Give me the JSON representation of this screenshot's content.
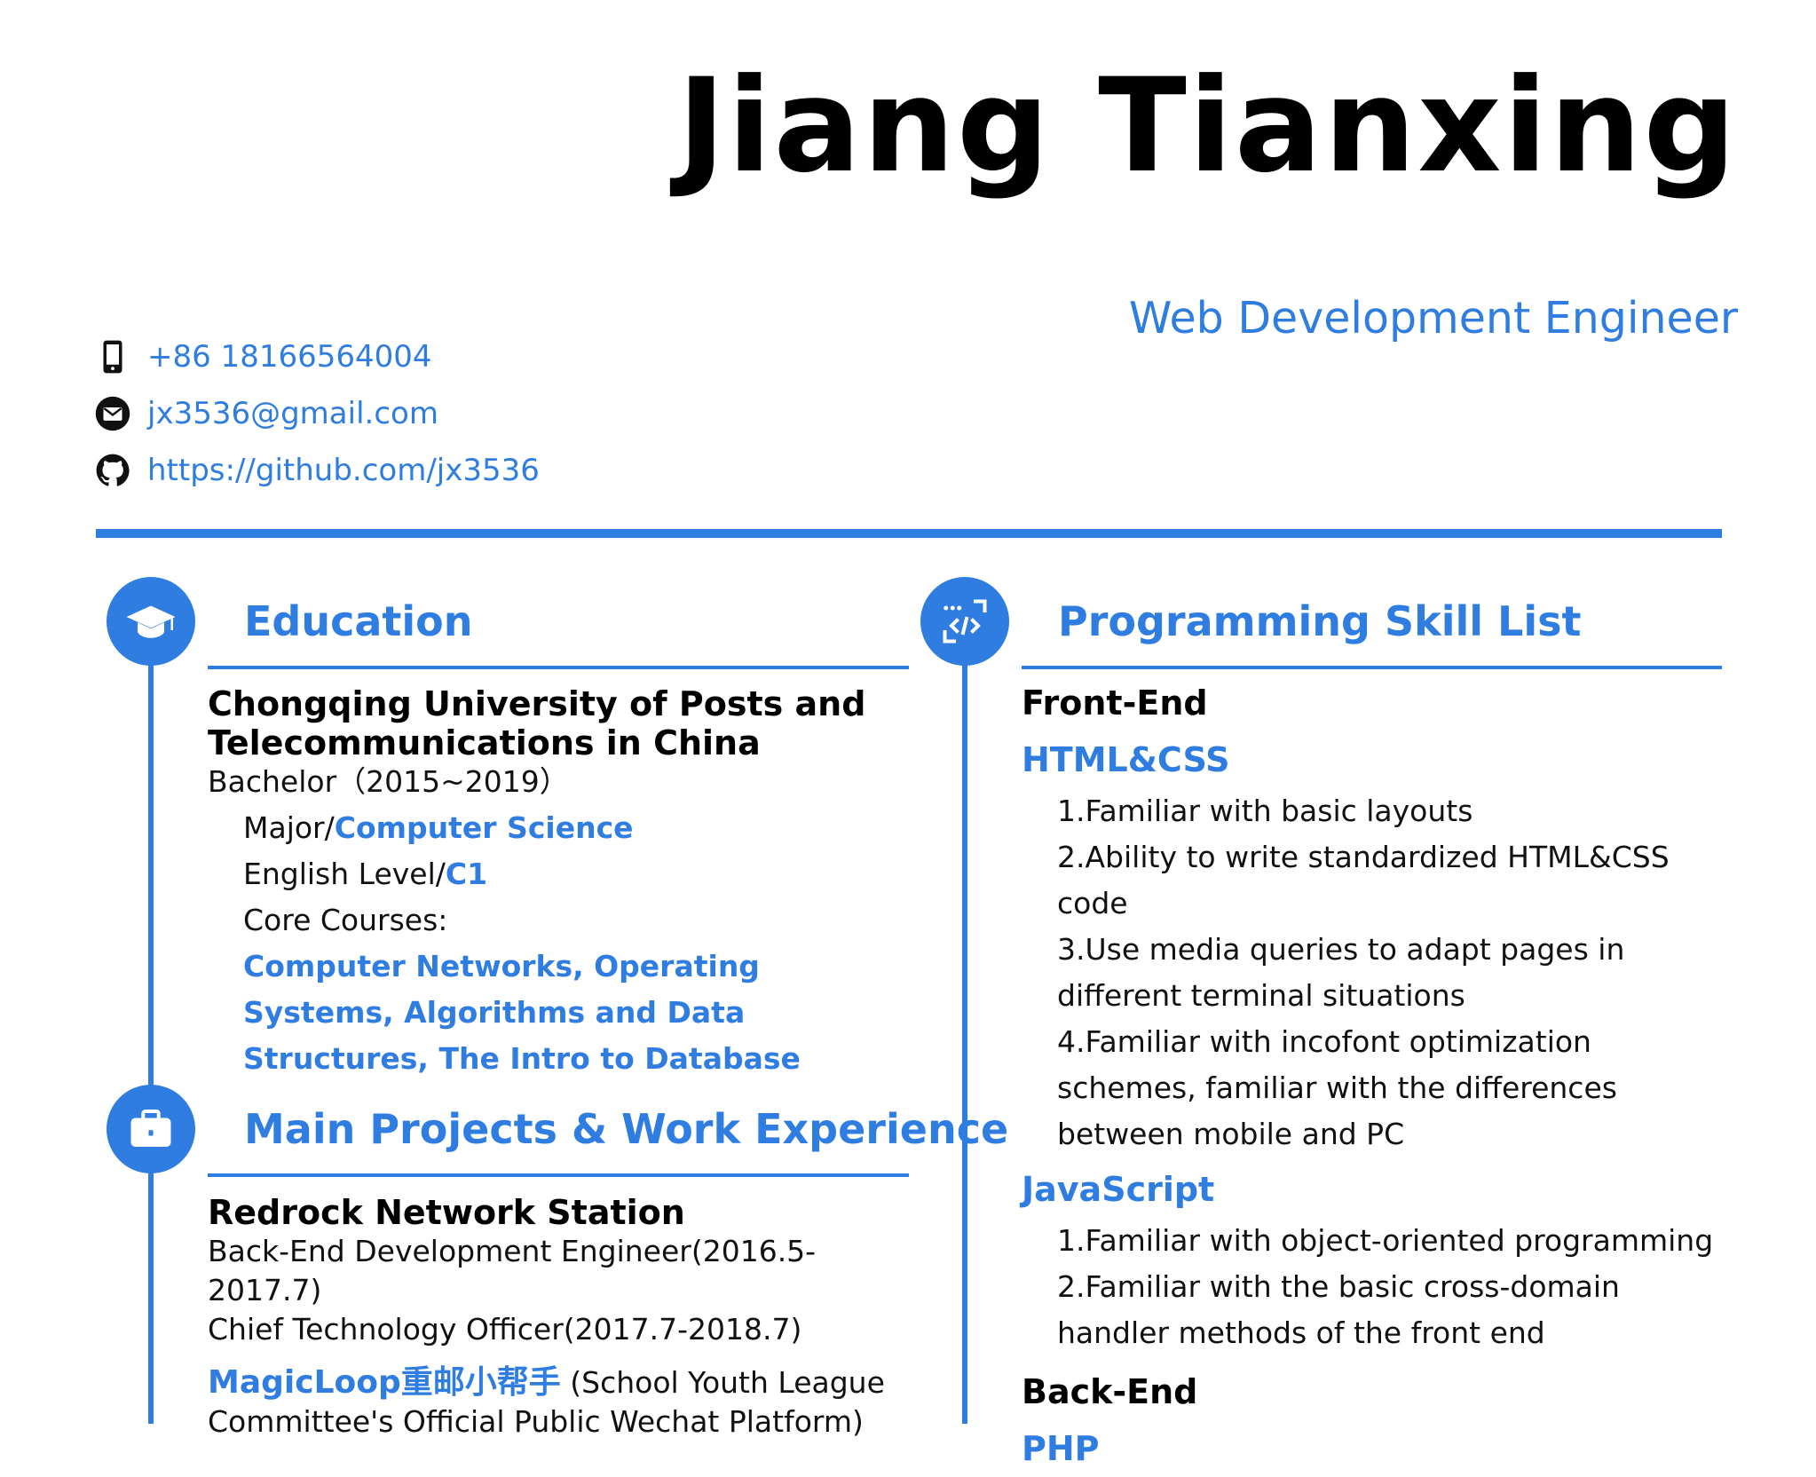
{
  "header": {
    "name": "Jiang Tianxing",
    "job_title": "Web Development Engineer"
  },
  "contacts": {
    "phone": "+86 18166564004",
    "email": "jx3536@gmail.com",
    "github": "https://github.com/jx3536"
  },
  "education": {
    "title": "Education",
    "school": "Chongqing University of Posts and Telecommunications in China",
    "degree": "Bachelor（2015~2019）",
    "major_label": "Major/",
    "major_value": "Computer Science",
    "english_label": "English Level/",
    "english_value": "C1",
    "courses_label": "Core Courses:",
    "courses_value": "Computer Networks, Operating Systems, Algorithms and Data Structures, The Intro to Database"
  },
  "projects": {
    "title": "Main Projects & Work Experience",
    "org": "Redrock Network Station",
    "role1": "Back-End Development Engineer(2016.5-2017.7)",
    "role2": "Chief Technology Officer(2017.7-2018.7)",
    "project_name": "MagicLoop重邮小帮手",
    "project_desc": "(School Youth League Committee's Official Public Wechat Platform)"
  },
  "skills": {
    "title": "Programming Skill List",
    "frontend_heading": "Front-End",
    "htmlcss_title": "HTML&CSS",
    "htmlcss_items": [
      "1.Familiar with basic layouts",
      "2.Ability to write standardized HTML&CSS code",
      "3.Use media queries to adapt pages in different terminal situations",
      "4.Familiar with incofont optimization schemes, familiar with the differences between mobile and PC"
    ],
    "js_title": "JavaScript",
    "js_items": [
      "1.Familiar with object-oriented programming",
      "2.Familiar with the basic cross-domain handler methods of the front end"
    ],
    "backend_heading": "Back-End",
    "php_title": "PHP"
  },
  "colors": {
    "accent": "#2f7de1",
    "text": "#111111"
  }
}
